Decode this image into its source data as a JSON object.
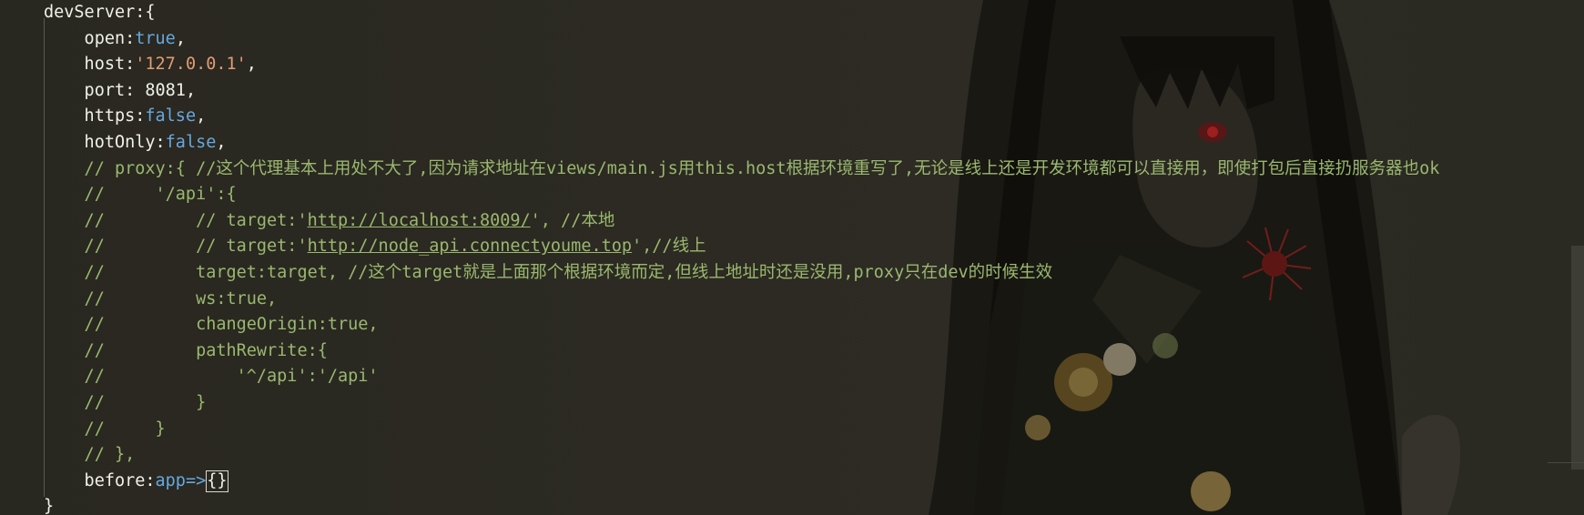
{
  "editor": {
    "lines": [
      {
        "segs": [
          [
            "key",
            "devServer"
          ],
          [
            "punc",
            ":{"
          ]
        ]
      },
      {
        "segs": [
          [
            "key",
            "    open"
          ],
          [
            "punc",
            ":"
          ],
          [
            "kw",
            "true"
          ],
          [
            "punc",
            ","
          ]
        ]
      },
      {
        "segs": [
          [
            "key",
            "    host"
          ],
          [
            "punc",
            ":"
          ],
          [
            "str",
            "'127.0.0.1'"
          ],
          [
            "punc",
            ","
          ]
        ]
      },
      {
        "segs": [
          [
            "key",
            "    port"
          ],
          [
            "punc",
            ": "
          ],
          [
            "num",
            "8081"
          ],
          [
            "punc",
            ","
          ]
        ]
      },
      {
        "segs": [
          [
            "key",
            "    https"
          ],
          [
            "punc",
            ":"
          ],
          [
            "kw",
            "false"
          ],
          [
            "punc",
            ","
          ]
        ]
      },
      {
        "segs": [
          [
            "key",
            "    hotOnly"
          ],
          [
            "punc",
            ":"
          ],
          [
            "kw",
            "false"
          ],
          [
            "punc",
            ","
          ]
        ]
      },
      {
        "segs": [
          [
            "cmt",
            "    // proxy:{ //这个代理基本上用处不大了,因为请求地址在views/main.js用this.host根据环境重写了,无论是线上还是开发环境都可以直接用，即使打包后直接扔服务器也ok"
          ]
        ]
      },
      {
        "segs": [
          [
            "cmt",
            "    //     '/api':{"
          ]
        ]
      },
      {
        "segs": [
          [
            "cmt",
            "    //         // target:'"
          ],
          [
            "url",
            "http://localhost:8009/"
          ],
          [
            "cmt",
            "', //本地"
          ]
        ]
      },
      {
        "segs": [
          [
            "cmt",
            "    //         // target:'"
          ],
          [
            "url",
            "http://node_api.connectyoume.top"
          ],
          [
            "cmt",
            "',//线上"
          ]
        ]
      },
      {
        "segs": [
          [
            "cmt",
            "    //         target:target, //这个target就是上面那个根据环境而定,但线上地址时还是没用,proxy只在dev的时候生效"
          ]
        ]
      },
      {
        "segs": [
          [
            "cmt",
            "    //         ws:true,"
          ]
        ]
      },
      {
        "segs": [
          [
            "cmt",
            "    //         changeOrigin:true,"
          ]
        ]
      },
      {
        "segs": [
          [
            "cmt",
            "    //         pathRewrite:{"
          ]
        ]
      },
      {
        "segs": [
          [
            "cmt",
            "    //             '^/api':'/api'"
          ]
        ]
      },
      {
        "segs": [
          [
            "cmt",
            "    //         }"
          ]
        ]
      },
      {
        "segs": [
          [
            "cmt",
            "    //     }"
          ]
        ]
      },
      {
        "segs": [
          [
            "cmt",
            "    // },"
          ]
        ]
      },
      {
        "segs": [
          [
            "key",
            "    before"
          ],
          [
            "punc",
            ":"
          ],
          [
            "kw",
            "app"
          ],
          [
            "op",
            "=>"
          ],
          [
            "cursor",
            "{}"
          ]
        ]
      },
      {
        "segs": [
          [
            "punc",
            "}"
          ]
        ]
      }
    ]
  },
  "theme": {
    "keyword": "#66a8e0",
    "string": "#e39b74",
    "comment": "#9ab86f",
    "text": "#f0f0ea",
    "background": "#2a2922"
  },
  "background_image": {
    "icon": "anime-girl-illustration"
  }
}
